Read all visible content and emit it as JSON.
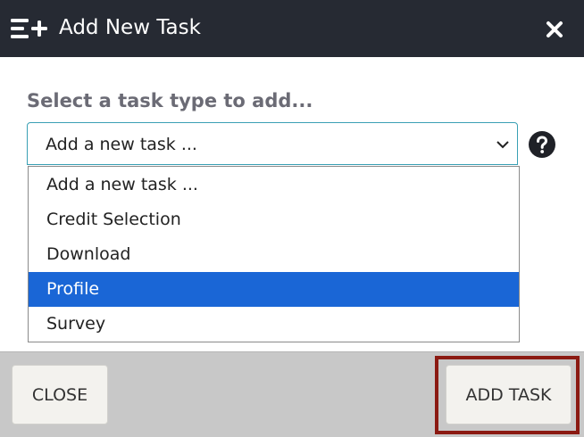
{
  "header": {
    "title": "Add New Task",
    "icon": "list-add-icon",
    "close_icon": "close-icon",
    "background": "#262a33"
  },
  "form": {
    "prompt": "Select a task type to add...",
    "select": {
      "value": "Add a new task ...",
      "border_color": "#3aa0b4"
    },
    "help_icon": "help-circle-icon",
    "options": [
      {
        "label": "Add a new task ...",
        "selected": false
      },
      {
        "label": "Credit Selection",
        "selected": false
      },
      {
        "label": "Download",
        "selected": false
      },
      {
        "label": "Profile",
        "selected": true
      },
      {
        "label": "Survey",
        "selected": false
      }
    ],
    "selected_color": "#1a66d6"
  },
  "footer": {
    "close_label": "CLOSE",
    "add_label": "ADD TASK",
    "highlight_color": "#8b1a12"
  }
}
